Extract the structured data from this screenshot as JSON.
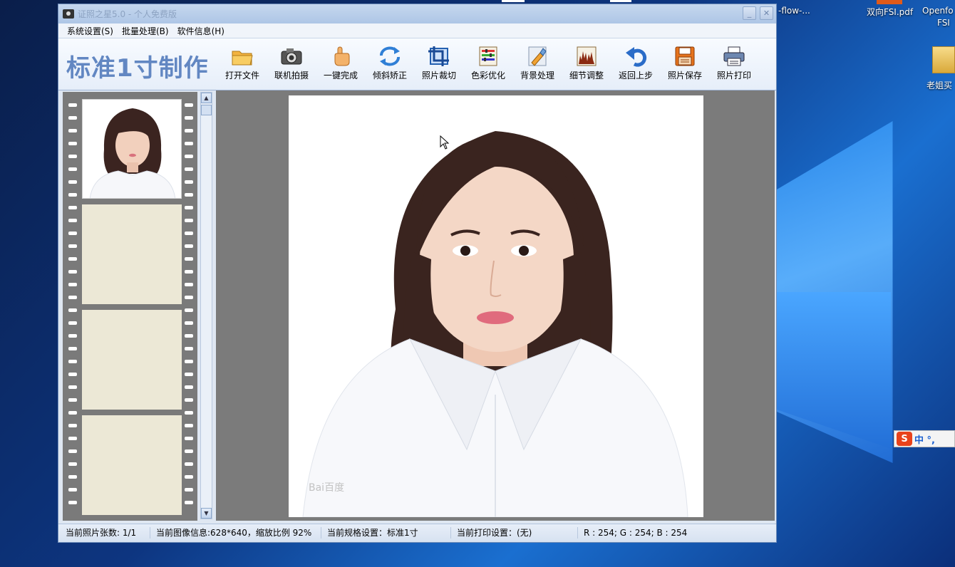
{
  "desktop": {
    "icons": [
      {
        "label": "-flow-...",
        "icon": "file-icon"
      },
      {
        "label": "双向FSI.pdf",
        "icon": "pdf-icon"
      },
      {
        "label": "Openfo",
        "sub": "FSI",
        "icon": "file-icon"
      },
      {
        "label": "老姐买",
        "icon": "folder-icon"
      }
    ],
    "ime": {
      "logo": "S",
      "text": "中 °,"
    }
  },
  "window": {
    "title": "证照之星5.0 - 个人免费版",
    "controls": {
      "minimize": "_",
      "close": "✕"
    }
  },
  "menu": [
    {
      "label": "系统设置(S)"
    },
    {
      "label": "批量处理(B)"
    },
    {
      "label": "软件信息(H)"
    }
  ],
  "toolbar": {
    "brand": "标准1寸制作",
    "tools": [
      {
        "label": "打开文件",
        "icon": "folder-open-icon"
      },
      {
        "label": "联机拍摄",
        "icon": "camera-icon"
      },
      {
        "label": "一键完成",
        "icon": "hand-pointer-icon"
      },
      {
        "label": "倾斜矫正",
        "icon": "rotate-icon"
      },
      {
        "label": "照片裁切",
        "icon": "crop-icon"
      },
      {
        "label": "色彩优化",
        "icon": "color-adjust-icon"
      },
      {
        "label": "背景处理",
        "icon": "brush-icon"
      },
      {
        "label": "细节调整",
        "icon": "histogram-icon"
      },
      {
        "label": "返回上步",
        "icon": "undo-icon"
      },
      {
        "label": "照片保存",
        "icon": "save-icon"
      },
      {
        "label": "照片打印",
        "icon": "printer-icon"
      }
    ]
  },
  "preview": {
    "watermark": "Bai百度"
  },
  "status": {
    "count": "当前照片张数: 1/1",
    "image_info": "当前图像信息:628*640，缩放比例 92%",
    "spec": "当前规格设置：标准1寸",
    "print": "当前打印设置：(无)",
    "rgb": "R : 254; G : 254; B : 254"
  }
}
